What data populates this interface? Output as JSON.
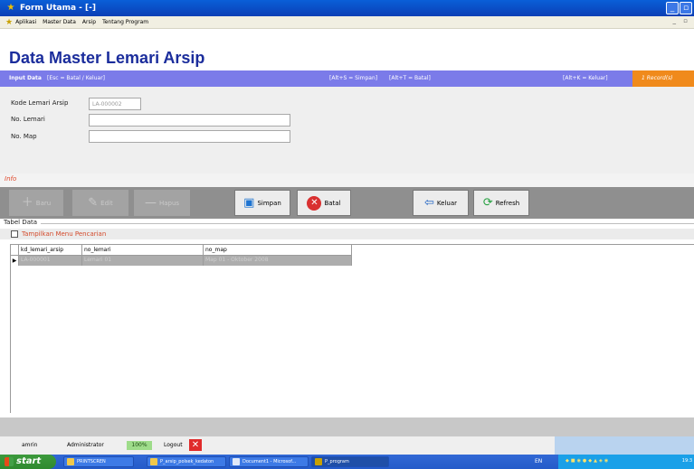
{
  "window": {
    "title": "Form Utama - [-]"
  },
  "menu": {
    "items": [
      "Aplikasi",
      "Master Data",
      "Arsip",
      "Tentang Program"
    ]
  },
  "header": {
    "title": "Data Master Lemari Arsip"
  },
  "strip": {
    "input_label": "Input Data",
    "esc_hint": "[Esc = Batal / Keluar]",
    "save_hint": "[Alt+S = Simpan]",
    "cancel_hint": "[Alt+T = Batal]",
    "exit_hint": "[Alt+K = Keluar]",
    "records": "1 Record(s)"
  },
  "form": {
    "kode_label": "Kode Lemari Arsip",
    "kode_value": "LA-000002",
    "lemari_label": "No. Lemari",
    "lemari_value": "",
    "map_label": "No. Map",
    "map_value": ""
  },
  "info": {
    "label": "Info"
  },
  "toolbar": {
    "baru": "Baru",
    "edit": "Edit",
    "hapus": "Hapus",
    "simpan": "Simpan",
    "batal": "Batal",
    "keluar": "Keluar",
    "refresh": "Refresh"
  },
  "table": {
    "section_label": "Tabel Data",
    "search_label": "Tampilkan Menu Pencarian",
    "columns": [
      "kd_lemari_arsip",
      "no_lemari",
      "no_map"
    ],
    "rows": [
      [
        "LA-000001",
        "Lemari 01",
        "Map 01 - Oktober 2008"
      ]
    ]
  },
  "status": {
    "user": "amrin",
    "role": "Administrator",
    "zoom": "100%",
    "logout": "Logout"
  },
  "taskbar": {
    "start": "start",
    "tasks": [
      "PRINTSCREN",
      "P_arsip_polsek_kedaton",
      "Document1 - Microsof...",
      "P_program"
    ],
    "lang": "EN",
    "clock": "19:3"
  }
}
